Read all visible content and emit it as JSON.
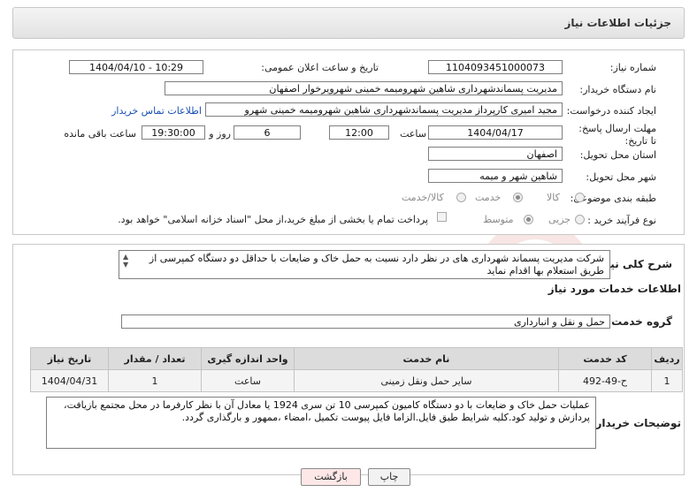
{
  "header": {
    "title": "جزئیات اطلاعات نیاز"
  },
  "fields": {
    "need_number_label": "شماره نیاز:",
    "need_number": "1104093451000073",
    "announce_label": "تاریخ و ساعت اعلان عمومی:",
    "announce_value": "1404/04/10 - 10:29",
    "buyer_org_label": "نام دستگاه خریدار:",
    "buyer_org": "مدیریت پسماندشهرداری شاهین شهرومیمه خمینی شهرویرخوار اصفهان",
    "creator_label": "ایجاد کننده درخواست:",
    "creator": "مجید امیری کارپرداز مدیریت پسماندشهرداری شاهین شهرومیمه خمینی شهرو",
    "contact_link": "اطلاعات تماس خریدار",
    "deadline_label": "مهلت ارسال پاسخ: تا تاریخ:",
    "deadline_date": "1404/04/17",
    "time_label": "ساعت",
    "deadline_time": "12:00",
    "days_value": "6",
    "days_label": "روز و",
    "remaining_time": "19:30:00",
    "remaining_label": "ساعت باقی مانده",
    "province_label": "استان محل تحویل:",
    "province": "اصفهان",
    "city_label": "شهر محل تحویل:",
    "city": "شاهین شهر و میمه",
    "category_label": "طبقه بندی موضوعی:",
    "category_options": [
      "کالا",
      "خدمت",
      "کالا/خدمت"
    ],
    "category_selected": 1,
    "process_label": "نوع فرآیند خرید :",
    "process_options": [
      "جزیی",
      "متوسط"
    ],
    "process_selected": 1,
    "payment_note": "پرداخت تمام یا بخشی از مبلغ خرید،از محل \"اسناد خزانه اسلامی\" خواهد بود."
  },
  "description": {
    "label": "شرح کلی نیاز:",
    "text": "شرکت مدیریت پسماند شهرداری های  در نظر دارد نسبت به حمل خاک و ضایعات با حداقل دو دستگاه کمپرسی از طریق استعلام بها  اقدام نماید"
  },
  "services": {
    "section_title": "اطلاعات خدمات مورد نیاز",
    "group_label": "گروه خدمت:",
    "group_value": "حمل و نقل و انبارداری",
    "columns": [
      "ردیف",
      "کد خدمت",
      "نام خدمت",
      "واحد اندازه گیری",
      "تعداد / مقدار",
      "تاریخ نیاز"
    ],
    "rows": [
      [
        "1",
        "ح-49-492",
        "سایر حمل ونقل زمینی",
        "ساعت",
        "1",
        "1404/04/31"
      ]
    ]
  },
  "buyer_notes": {
    "label": "توضیحات خریدار:",
    "text": "عملیات حمل خاک و ضایعات با دو دستگاه کامیون کمپرسی 10 تن سری 1924 یا معادل آن با نظر کارفرما در محل مجتمع بازیافت، پردازش و تولید کود.کلیه شرایط طبق فایل.الزاما فایل پیوست تکمیل ،امضاء ،ممهور و بارگذاری گردد."
  },
  "buttons": {
    "print": "چاپ",
    "back": "بازگشت"
  },
  "watermark_text": "AriaTender.neT",
  "colors": {
    "link": "#1a4fb3",
    "back_button_bg": "#fde7e7",
    "watermark": "#c0392b"
  }
}
